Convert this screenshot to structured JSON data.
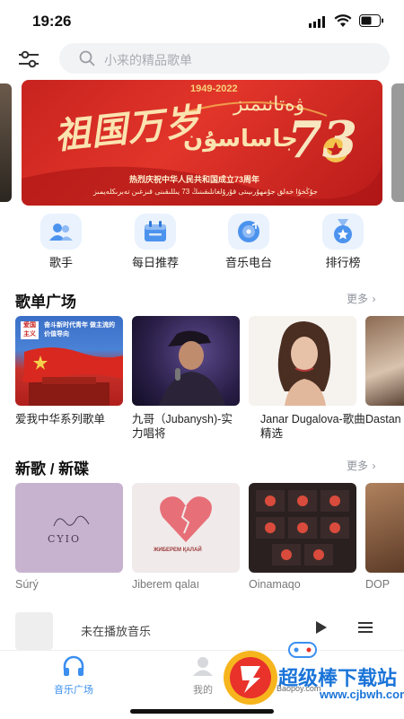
{
  "status_bar": {
    "time": "19:26"
  },
  "search": {
    "placeholder": "小来的精品歌单"
  },
  "banner": {
    "years": "1949-2022",
    "headline": "祖国万岁",
    "uyghur_top": "ۋەتانىمىز",
    "uyghur_bottom": "جاساسۇن",
    "number": "73",
    "subtitle": "热烈庆祝中华人民共和国成立73周年",
    "uyghur_footer": "جۇڭخۇا خەلق جۇمھۇرىيىتى قۇرۇلغانلىقىنىڭ 73 يىللىقىنى قىزغىن تەبرىكلەيمىز"
  },
  "quick_nav": [
    {
      "label": "歌手",
      "icon": "singer-icon"
    },
    {
      "label": "每日推荐",
      "icon": "calendar-icon"
    },
    {
      "label": "音乐电台",
      "icon": "radio-icon"
    },
    {
      "label": "排行榜",
      "icon": "medal-icon"
    }
  ],
  "playlist_section": {
    "title": "歌单广场",
    "more": "更多",
    "cover1_badge": "爱国主义",
    "cover1_text": "奋斗新时代青年 做主流的价值导向",
    "items": [
      {
        "title": "爱我中华系列歌单"
      },
      {
        "title": "九哥（Jubanysh)-实力唱将"
      },
      {
        "title": "Janar Dugalova-歌曲精选"
      },
      {
        "title": "Dastan（精选"
      }
    ]
  },
  "new_section": {
    "title": "新歌 / 新碟",
    "more": "更多",
    "cover1_text": "CYIO",
    "cover2_text": "ЖИБЕРЕМ ҚАЛАЙ",
    "items": [
      {
        "title": "Súrý"
      },
      {
        "title": "Jiberem qalaı"
      },
      {
        "title": "Oinamaqo"
      },
      {
        "title": "DOP"
      }
    ]
  },
  "player": {
    "status": "未在播放音乐"
  },
  "tabbar": {
    "items": [
      {
        "label": "音乐广场"
      },
      {
        "label": "我的"
      }
    ]
  },
  "watermark": {
    "text": "超级棒下载站",
    "url": "www.cjbwh.com",
    "sub": "Baopoy.com"
  },
  "colors": {
    "accent": "#3b8ff0",
    "banner_red": "#d42a22",
    "text": "#222222",
    "muted": "#8e939b"
  }
}
